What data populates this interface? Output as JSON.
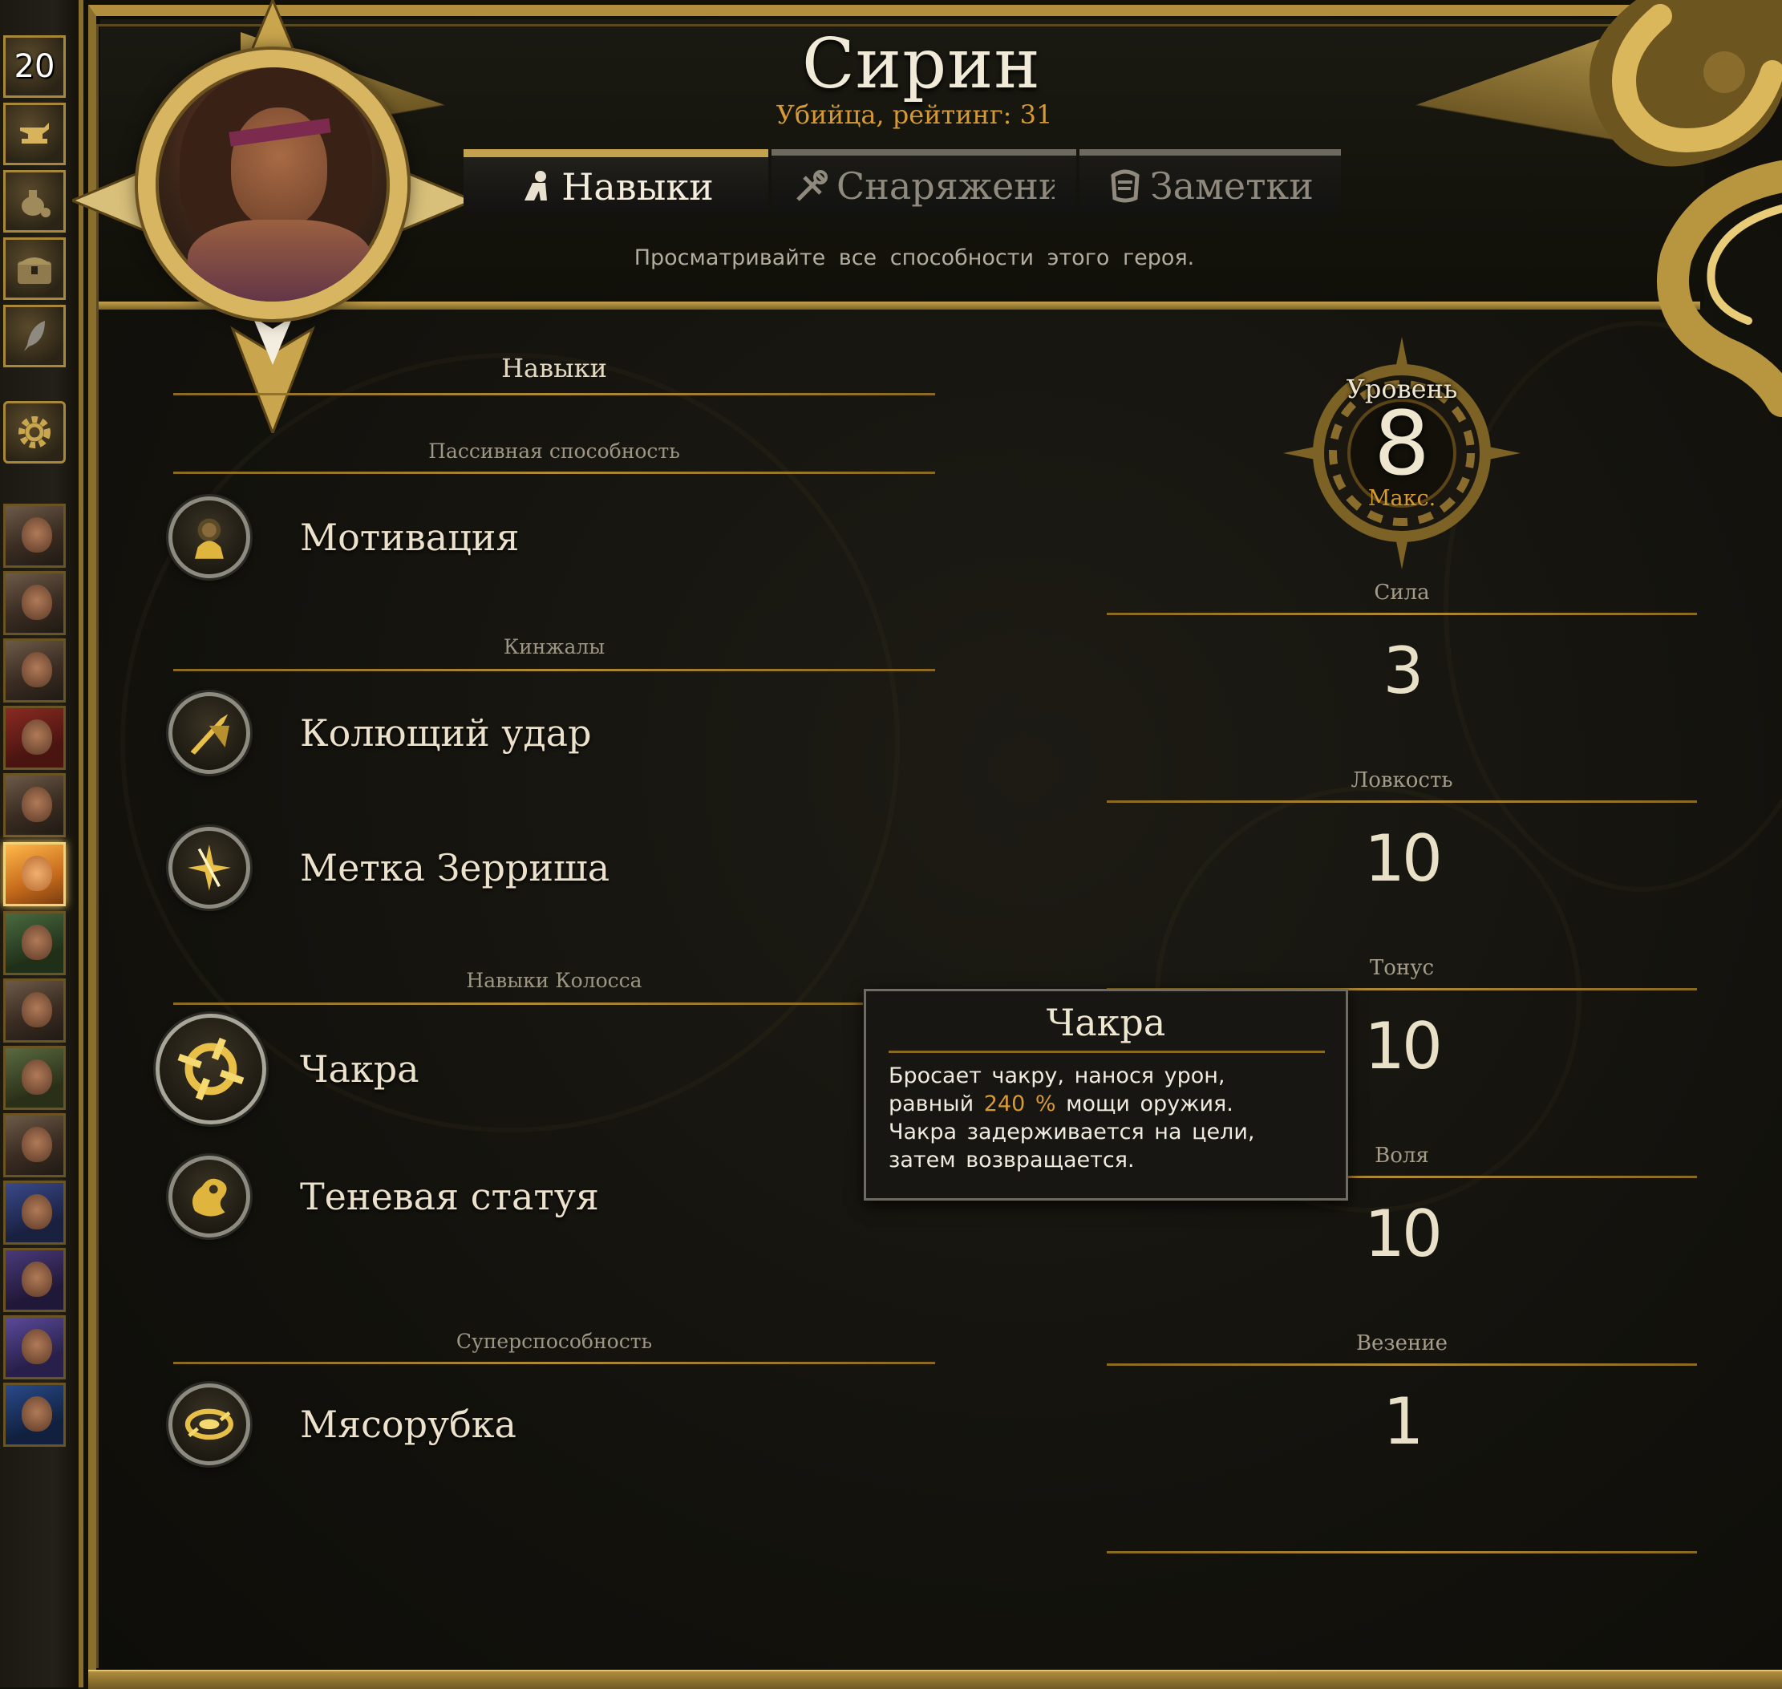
{
  "sidebar": {
    "counter": "20",
    "buttons": [
      "anvil-icon",
      "potion-bag-icon",
      "chest-icon",
      "quill-icon"
    ],
    "settings_icon": "gear-icon",
    "heroes_count": 14,
    "active_hero_index": 5
  },
  "hero": {
    "name": "Сирин",
    "subtitle": "Убийца, рейтинг: 31"
  },
  "tabs": [
    {
      "label": "Навыки",
      "icon": "skills-icon",
      "active": true
    },
    {
      "label": "Снаряжение",
      "icon": "equipment-icon",
      "active": false
    },
    {
      "label": "Заметки",
      "icon": "notes-icon",
      "active": false
    }
  ],
  "tab_description": "Просматривайте все способности этого героя.",
  "skills": {
    "title": "Навыки",
    "sections": [
      {
        "label": "Пассивная способность",
        "items": [
          {
            "name": "Мотивация",
            "icon": "motivation-icon"
          }
        ]
      },
      {
        "label": "Кинжалы",
        "items": [
          {
            "name": "Колющий удар",
            "icon": "stab-icon"
          },
          {
            "name": "Метка Зерриша",
            "icon": "zerrish-mark-icon"
          }
        ]
      },
      {
        "label": "Навыки Колосса",
        "items": [
          {
            "name": "Чакра",
            "icon": "chakram-icon"
          },
          {
            "name": "Теневая статуя",
            "icon": "shadow-statue-icon"
          }
        ]
      },
      {
        "label": "Суперспособность",
        "items": [
          {
            "name": "Мясорубка",
            "icon": "meat-grinder-icon"
          }
        ]
      }
    ]
  },
  "level": {
    "title": "Уровень",
    "value": "8",
    "note": "Макс."
  },
  "stats": [
    {
      "label": "Сила",
      "value": "3"
    },
    {
      "label": "Ловкость",
      "value": "10"
    },
    {
      "label": "Тонус",
      "value": "10"
    },
    {
      "label": "Воля",
      "value": "10"
    },
    {
      "label": "Везение",
      "value": "1"
    }
  ],
  "tooltip": {
    "title": "Чакра",
    "text_before": "Бросает чакру, нанося урон, равный",
    "highlight": "240 %",
    "text_after": "мощи оружия. Чакра задерживается на цели, затем возвращается."
  },
  "colors": {
    "gold": "#b08e3e",
    "accent_orange": "#d79a33",
    "text": "#e6dcc2"
  }
}
